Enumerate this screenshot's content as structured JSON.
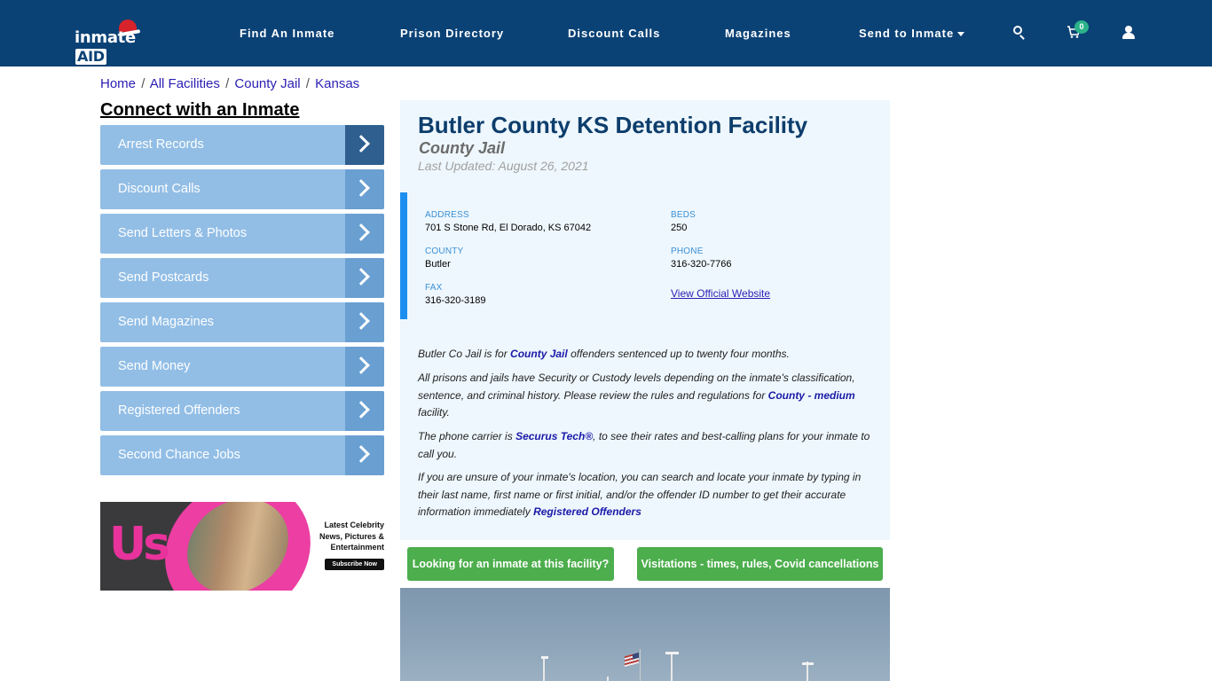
{
  "header": {
    "logo": {
      "text_main": "inmate",
      "text_accent": "AID"
    },
    "nav": [
      {
        "label": "Find An Inmate"
      },
      {
        "label": "Prison Directory"
      },
      {
        "label": "Discount Calls"
      },
      {
        "label": "Magazines"
      },
      {
        "label": "Send to Inmate",
        "has_dropdown": true
      }
    ],
    "icons": {
      "search": "search-icon",
      "cart": "cart-icon",
      "user": "user-icon"
    },
    "cart_count": "0",
    "colors": {
      "bar": "#0b4276",
      "badge": "#2bb38a"
    }
  },
  "breadcrumb": [
    {
      "label": "Home"
    },
    {
      "label": "All Facilities"
    },
    {
      "label": "County Jail"
    },
    {
      "label": "Kansas"
    }
  ],
  "breadcrumb_sep": "/",
  "sidebar": {
    "title": "Connect with an Inmate",
    "items": [
      {
        "label": "Arrest Records",
        "active": true
      },
      {
        "label": "Discount Calls"
      },
      {
        "label": "Send Letters & Photos"
      },
      {
        "label": "Send Postcards"
      },
      {
        "label": "Send Magazines"
      },
      {
        "label": "Send Money"
      },
      {
        "label": "Registered Offenders"
      },
      {
        "label": "Second Chance Jobs"
      }
    ],
    "ad": {
      "brand": "Us",
      "headline_lines": [
        "Latest Celebrity",
        "News, Pictures &",
        "Entertainment"
      ],
      "cta": "Subscribe Now"
    }
  },
  "facility": {
    "name": "Butler County KS Detention Facility",
    "type": "County Jail",
    "last_updated": "Last Updated: August 26, 2021",
    "info": {
      "address_label": "ADDRESS",
      "address": "701 S Stone Rd, El Dorado, KS 67042",
      "county_label": "COUNTY",
      "county": "Butler",
      "fax_label": "FAX",
      "fax": "316-320-3189",
      "beds_label": "BEDS",
      "beds": "250",
      "phone_label": "PHONE",
      "phone": "316-320-7766",
      "website_link": "View Official Website"
    },
    "description": {
      "p1": {
        "pre": "Butler Co Jail is for ",
        "link": "County Jail",
        "post": " offenders sentenced up to twenty four months."
      },
      "p2": {
        "pre": "All prisons and jails have Security or Custody levels depending on the inmate's classification, sentence, and criminal history. Please review the rules and regulations for ",
        "link": "County - medium",
        "post": " facility."
      },
      "p3": {
        "pre": "The phone carrier is ",
        "link": "Securus Tech®",
        "post": ", to see their rates and best-calling plans for your inmate to call you."
      },
      "p4": {
        "pre": "If you are unsure of your inmate's location, you can search and locate your inmate by typing in their last name, first name or first initial, and/or the offender ID number to get their accurate information immediately ",
        "link": "Registered Offenders",
        "post": ""
      }
    },
    "buttons": {
      "find_inmate": "Looking for an inmate at this facility?",
      "visitations": "Visitations - times, rules, Covid cancellations"
    }
  }
}
